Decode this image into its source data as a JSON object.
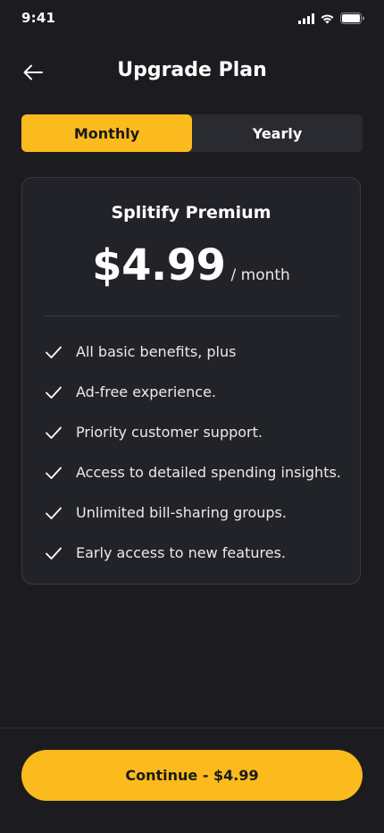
{
  "status_bar": {
    "time": "9:41"
  },
  "header": {
    "title": "Upgrade Plan"
  },
  "billing_toggle": {
    "tabs": [
      {
        "label": "Monthly",
        "active": true
      },
      {
        "label": "Yearly",
        "active": false
      }
    ]
  },
  "plan": {
    "name": "Splitify Premium",
    "price": "$4.99",
    "period": "/ month",
    "features": [
      "All basic benefits, plus",
      "Ad-free experience.",
      "Priority customer support.",
      "Access to detailed spending insights.",
      "Unlimited bill-sharing groups.",
      "Early access to new features."
    ]
  },
  "footer": {
    "continue_label": "Continue - $4.99"
  },
  "colors": {
    "accent": "#fbba1d",
    "background": "#1c1c20",
    "card": "#222329"
  }
}
